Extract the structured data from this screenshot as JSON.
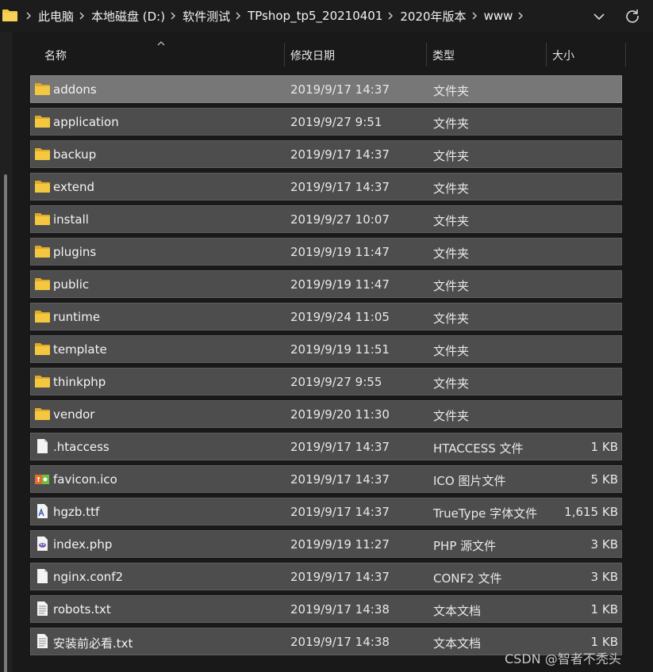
{
  "address_bar": {
    "crumbs": [
      "此电脑",
      "本地磁盘 (D:)",
      "软件测试",
      "TPshop_tp5_20210401",
      "2020年版本",
      "www"
    ]
  },
  "columns": {
    "name": "名称",
    "modified": "修改日期",
    "type": "类型",
    "size": "大小"
  },
  "files": [
    {
      "name": "addons",
      "modified": "2019/9/17 14:37",
      "type": "文件夹",
      "size": "",
      "icon": "folder-icon"
    },
    {
      "name": "application",
      "modified": "2019/9/27 9:51",
      "type": "文件夹",
      "size": "",
      "icon": "folder-icon"
    },
    {
      "name": "backup",
      "modified": "2019/9/17 14:37",
      "type": "文件夹",
      "size": "",
      "icon": "folder-icon"
    },
    {
      "name": "extend",
      "modified": "2019/9/17 14:37",
      "type": "文件夹",
      "size": "",
      "icon": "folder-icon"
    },
    {
      "name": "install",
      "modified": "2019/9/27 10:07",
      "type": "文件夹",
      "size": "",
      "icon": "folder-icon"
    },
    {
      "name": "plugins",
      "modified": "2019/9/19 11:47",
      "type": "文件夹",
      "size": "",
      "icon": "folder-icon"
    },
    {
      "name": "public",
      "modified": "2019/9/19 11:47",
      "type": "文件夹",
      "size": "",
      "icon": "folder-icon"
    },
    {
      "name": "runtime",
      "modified": "2019/9/24 11:05",
      "type": "文件夹",
      "size": "",
      "icon": "folder-icon"
    },
    {
      "name": "template",
      "modified": "2019/9/19 11:51",
      "type": "文件夹",
      "size": "",
      "icon": "folder-icon"
    },
    {
      "name": "thinkphp",
      "modified": "2019/9/27 9:55",
      "type": "文件夹",
      "size": "",
      "icon": "folder-icon"
    },
    {
      "name": "vendor",
      "modified": "2019/9/20 11:30",
      "type": "文件夹",
      "size": "",
      "icon": "folder-icon"
    },
    {
      "name": ".htaccess",
      "modified": "2019/9/17 14:37",
      "type": "HTACCESS 文件",
      "size": "1 KB",
      "icon": "file-icon"
    },
    {
      "name": "favicon.ico",
      "modified": "2019/9/17 14:37",
      "type": "ICO 图片文件",
      "size": "5 KB",
      "icon": "ico-image-icon"
    },
    {
      "name": "hgzb.ttf",
      "modified": "2019/9/17 14:37",
      "type": "TrueType 字体文件",
      "size": "1,615 KB",
      "icon": "font-file-icon"
    },
    {
      "name": "index.php",
      "modified": "2019/9/19 11:27",
      "type": "PHP 源文件",
      "size": "3 KB",
      "icon": "php-file-icon"
    },
    {
      "name": "nginx.conf2",
      "modified": "2019/9/17 14:37",
      "type": "CONF2 文件",
      "size": "3 KB",
      "icon": "file-icon"
    },
    {
      "name": "robots.txt",
      "modified": "2019/9/17 14:38",
      "type": "文本文档",
      "size": "1 KB",
      "icon": "text-file-icon"
    },
    {
      "name": "安装前必看.txt",
      "modified": "2019/9/17 14:38",
      "type": "文本文档",
      "size": "1 KB",
      "icon": "text-file-icon"
    }
  ],
  "selected_index": 0,
  "watermark": "CSDN @智者不秃头",
  "colors": {
    "folder": "#f3c73f",
    "row_bg": "#4d4d4d",
    "row_selected": "#777777",
    "background": "#191919"
  }
}
